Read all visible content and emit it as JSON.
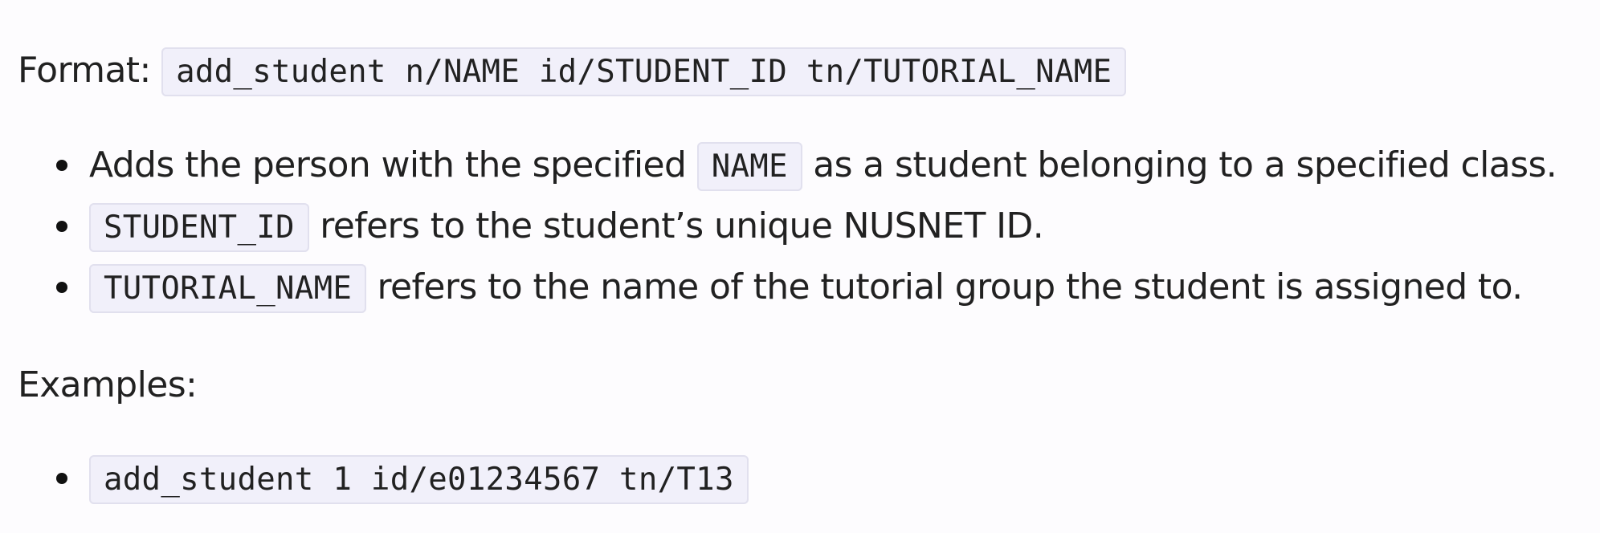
{
  "format": {
    "label": "Format:",
    "command": "add_student n/NAME id/STUDENT_ID tn/TUTORIAL_NAME"
  },
  "description": [
    {
      "pre": "Adds the person with the specified",
      "code": "NAME",
      "post": "as a student belonging to a specified class."
    },
    {
      "code": "STUDENT_ID",
      "post": "refers to the student’s unique NUSNET ID."
    },
    {
      "code": "TUTORIAL_NAME",
      "post": "refers to the name of the tutorial group the student is assigned to."
    }
  ],
  "examples": {
    "label": "Examples:",
    "items": [
      "add_student 1 id/e01234567 tn/T13"
    ]
  }
}
